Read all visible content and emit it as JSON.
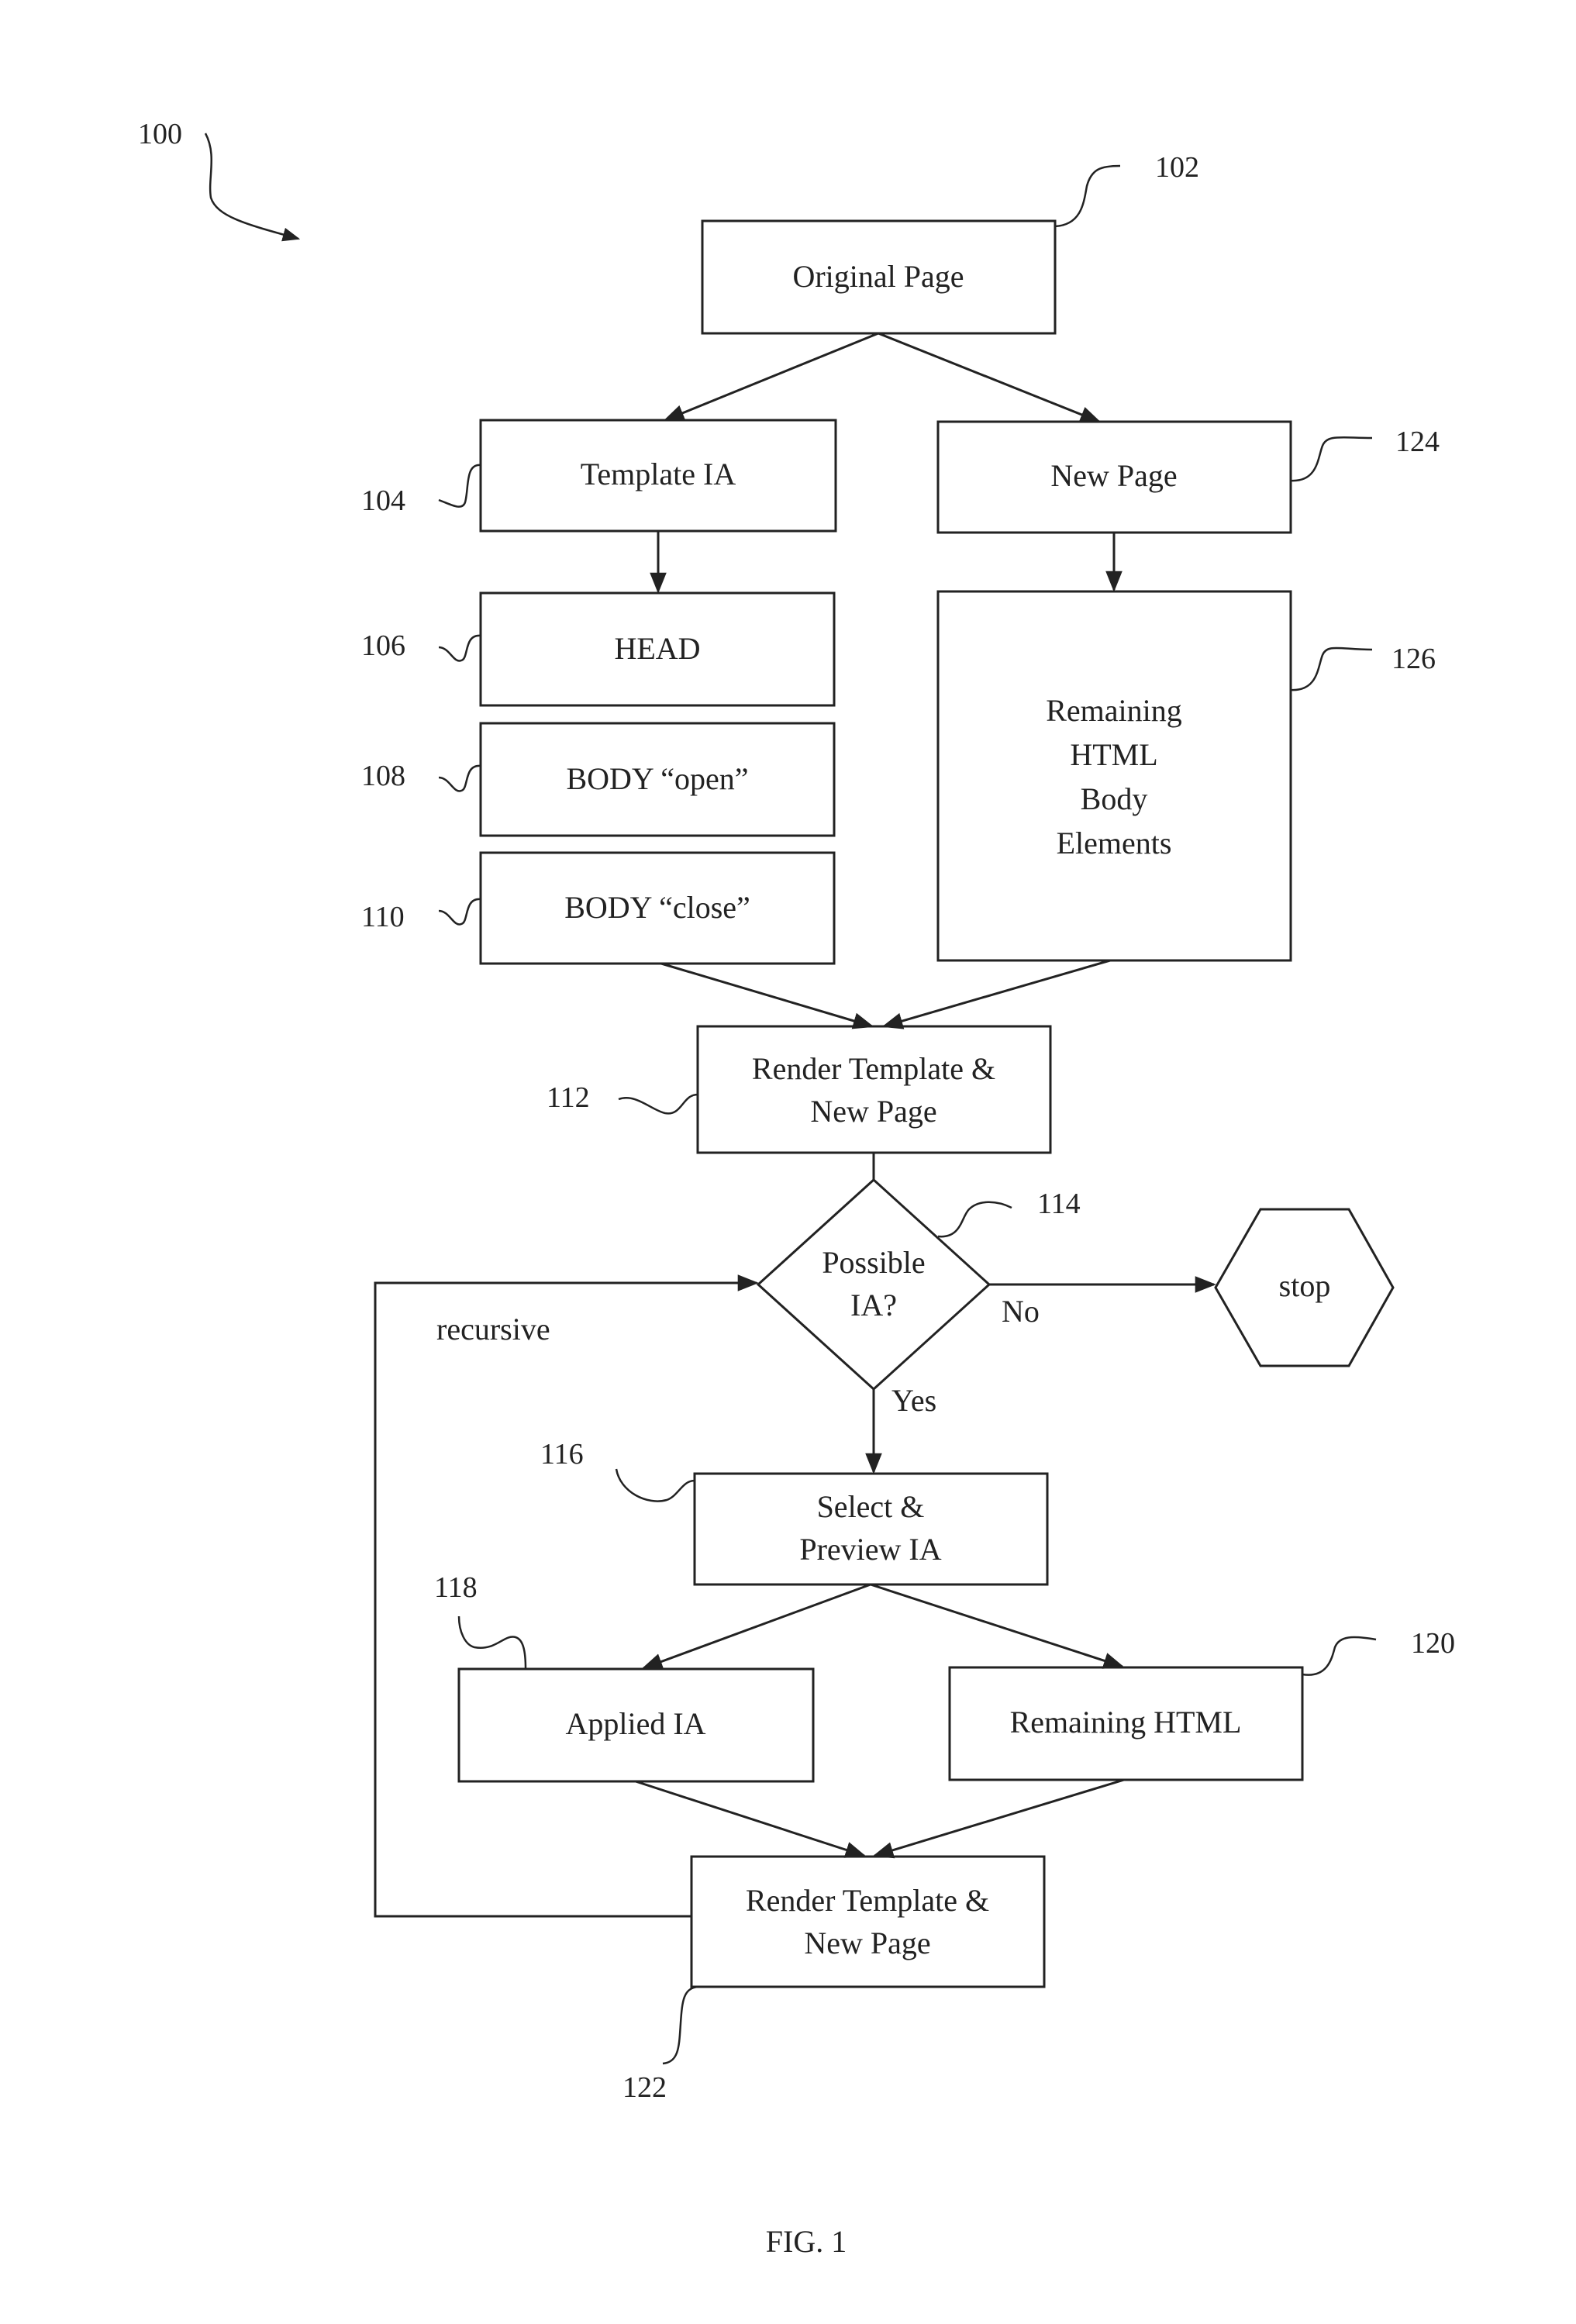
{
  "figure": {
    "caption": "FIG. 1",
    "reference": "100"
  },
  "nodes": {
    "original_page": {
      "ref": "102",
      "lines": [
        "Original Page"
      ]
    },
    "template_ia": {
      "ref": "104",
      "lines": [
        "Template IA"
      ]
    },
    "head": {
      "ref": "106",
      "lines": [
        "HEAD"
      ]
    },
    "body_open": {
      "ref": "108",
      "lines": [
        "BODY “open”"
      ]
    },
    "body_close": {
      "ref": "110",
      "lines": [
        "BODY “close”"
      ]
    },
    "new_page": {
      "ref": "124",
      "lines": [
        "New Page"
      ]
    },
    "remaining_body": {
      "ref": "126",
      "lines": [
        "Remaining",
        "HTML",
        "Body",
        "Elements"
      ]
    },
    "render_1": {
      "ref": "112",
      "lines": [
        "Render Template &",
        "New Page"
      ]
    },
    "decision": {
      "ref": "114",
      "lines": [
        "Possible",
        "IA?"
      ]
    },
    "stop": {
      "lines": [
        "stop"
      ]
    },
    "select_preview": {
      "ref": "116",
      "lines": [
        "Select &",
        "Preview IA"
      ]
    },
    "applied_ia": {
      "ref": "118",
      "lines": [
        "Applied IA"
      ]
    },
    "remaining_html": {
      "ref": "120",
      "lines": [
        "Remaining HTML"
      ]
    },
    "render_2": {
      "ref": "122",
      "lines": [
        "Render Template &",
        "New Page"
      ]
    }
  },
  "edge_labels": {
    "no": "No",
    "yes": "Yes",
    "recursive": "recursive"
  }
}
